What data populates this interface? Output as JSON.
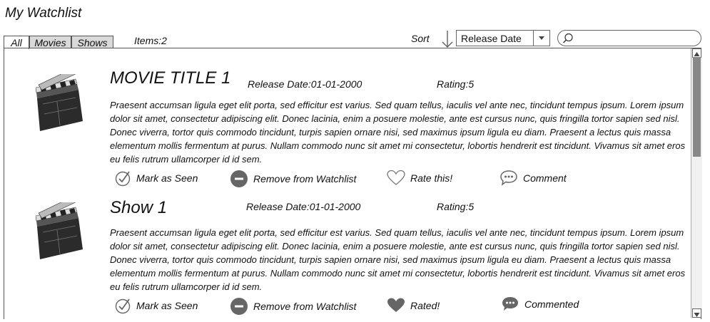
{
  "app": {
    "title": "My Watchlist"
  },
  "tabs": [
    {
      "label": "All",
      "active": true
    },
    {
      "label": "Movies",
      "active": false
    },
    {
      "label": "Shows",
      "active": false
    }
  ],
  "items_count": "Items:2",
  "sort": {
    "label": "Sort",
    "selected": "Release Date"
  },
  "search": {
    "placeholder": ""
  },
  "items": [
    {
      "title": "MOVIE TITLE 1",
      "release": "Release Date:01-01-2000",
      "rating": "Rating:5",
      "description": "Praesent accumsan ligula eget elit porta, sed efficitur est varius. Sed quam tellus, iaculis vel ante nec, tincidunt tempus ipsum. Lorem ipsum dolor sit amet, consectetur adipiscing elit. Donec lacinia, enim a posuere molestie, ante est cursus nunc, quis fringilla tortor sapien sed nisl. Donec viverra, tortor quis commodo tincidunt, turpis sapien ornare nisi, sed maximus ipsum ligula eu diam. Praesent a lectus quis massa elementum mollis fermentum at purus. Nullam commodo nunc sit amet mi consectetur, lobortis hendrerit est tincidunt. Vivamus sit amet eros eu felis rutrum ullamcorper id id sem.",
      "actions": {
        "seen": "Mark as Seen",
        "remove": "Remove from Watchlist",
        "rate": "Rate this!",
        "comment": "Comment"
      }
    },
    {
      "title": "Show 1",
      "release": "Release Date:01-01-2000",
      "rating": "Rating:5",
      "description": "Praesent accumsan ligula eget elit porta, sed efficitur est varius. Sed quam tellus, iaculis vel ante nec, tincidunt tempus ipsum. Lorem ipsum dolor sit amet, consectetur adipiscing elit. Donec lacinia, enim a posuere molestie, ante est cursus nunc, quis fringilla tortor sapien sed nisl. Donec viverra, tortor quis commodo tincidunt, turpis sapien ornare nisi, sed maximus ipsum ligula eu diam. Praesent a lectus quis massa elementum mollis fermentum at purus. Nullam commodo nunc sit amet mi consectetur, lobortis hendrerit est tincidunt. Vivamus sit amet eros eu felis rutrum ullamcorper id id sem.",
      "actions": {
        "seen": "Mark as Seen",
        "remove": "Remove from Watchlist",
        "rate": "Rated!",
        "comment": "Commented"
      }
    }
  ],
  "icons": {
    "thumbnail": "clapperboard-icon",
    "seen": "check-circle-icon",
    "remove": "minus-circle-icon",
    "rate_empty": "heart-outline-icon",
    "rate_filled": "heart-filled-icon",
    "comment": "speech-bubble-icon",
    "sort": "arrow-down-icon",
    "search": "search-icon"
  }
}
